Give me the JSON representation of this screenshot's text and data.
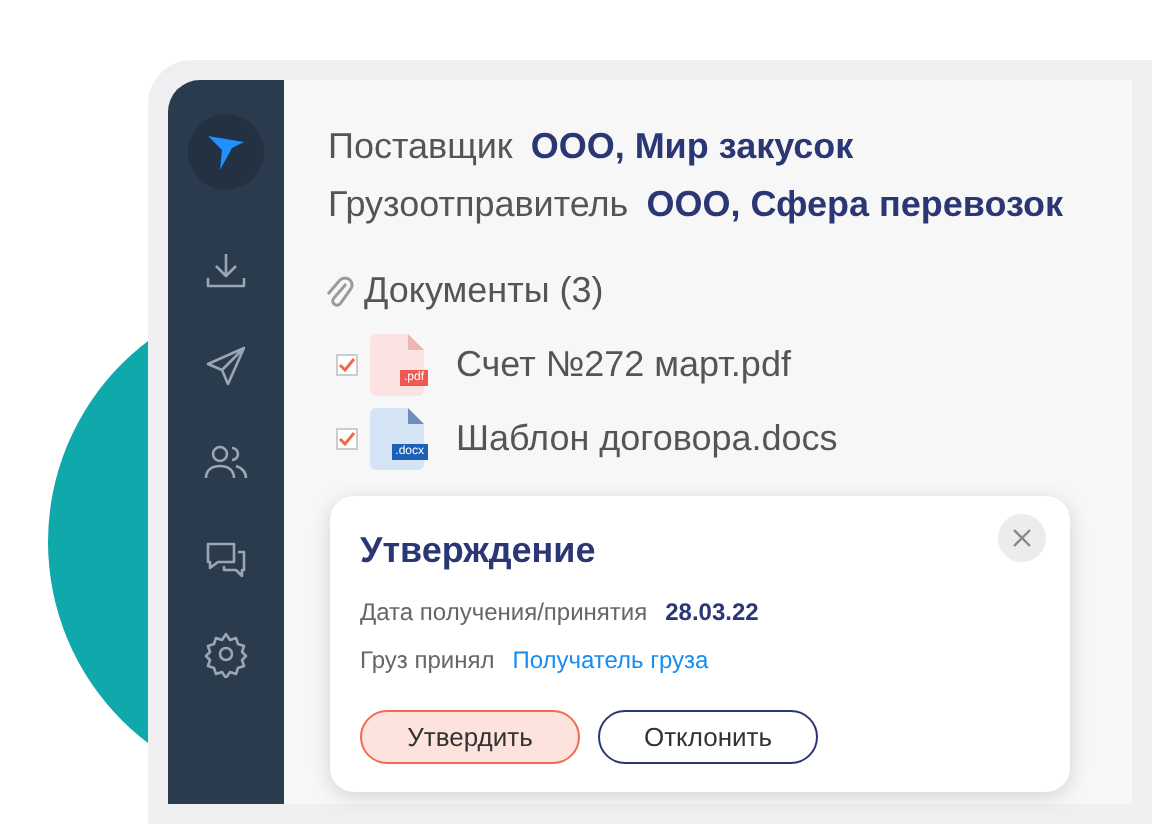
{
  "sidebar": {
    "items": [
      {
        "kind": "download"
      },
      {
        "kind": "send"
      },
      {
        "kind": "users"
      },
      {
        "kind": "chat"
      },
      {
        "kind": "settings"
      }
    ]
  },
  "details": [
    {
      "label": "Поставщик",
      "value": "ООО, Мир закусок"
    },
    {
      "label": "Грузоотправитель",
      "value": "ООО, Сфера перевозок"
    }
  ],
  "documents": {
    "title": "Документы (3)",
    "files": [
      {
        "name": "Счет №272 март.pdf",
        "kind": "pdf",
        "ext": ".pdf",
        "checked": true
      },
      {
        "name": "Шаблон договора.docs",
        "kind": "docx",
        "ext": ".docx",
        "checked": true
      }
    ]
  },
  "dialog": {
    "title": "Утверждение",
    "rows": [
      {
        "label": "Дата получения/принятия",
        "value": "28.03.22",
        "kind": "bold"
      },
      {
        "label": "Груз принял",
        "value": "Получатель груза",
        "kind": "link"
      }
    ],
    "buttons": [
      {
        "label": "Утвердить",
        "kind": "primary"
      },
      {
        "label": "Отклонить",
        "kind": "secondary"
      }
    ]
  }
}
